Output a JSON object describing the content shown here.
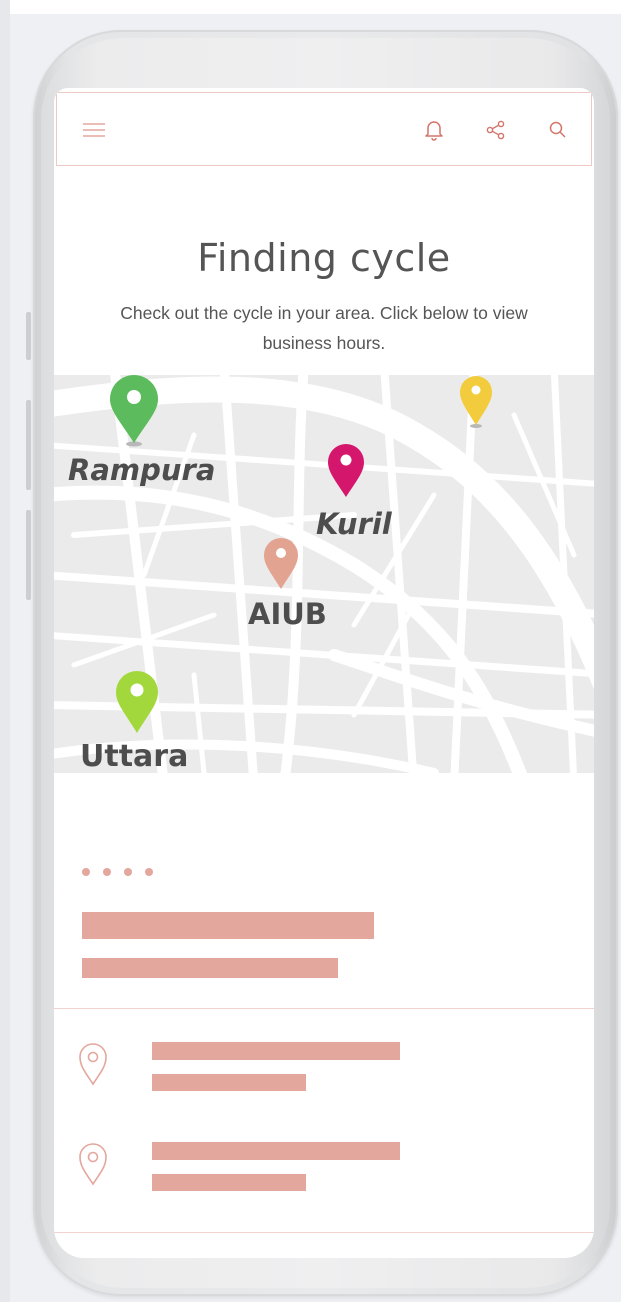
{
  "header": {
    "menu_icon": "hamburger-menu-icon",
    "notification_icon": "bell-icon",
    "share_icon": "share-icon",
    "search_icon": "search-icon"
  },
  "page": {
    "title": "Finding cycle",
    "subtitle": "Check out the cycle in your area. Click below to view business hours."
  },
  "map": {
    "locations": [
      {
        "label": "Rampura",
        "pin_color": "#5cbb5c"
      },
      {
        "label": "Kuril",
        "pin_color": "#d4166c"
      },
      {
        "label": "AIUB",
        "pin_color": "#e3a391"
      },
      {
        "label": "Uttara",
        "pin_color": "#a3d83d"
      },
      {
        "label": "",
        "pin_color": "#f2cc3c"
      }
    ]
  },
  "colors": {
    "accent": "#e3a79d",
    "text": "#555555",
    "divider": "#f0d3cf"
  },
  "list": {
    "item_icon": "location-pin-outline-icon"
  }
}
